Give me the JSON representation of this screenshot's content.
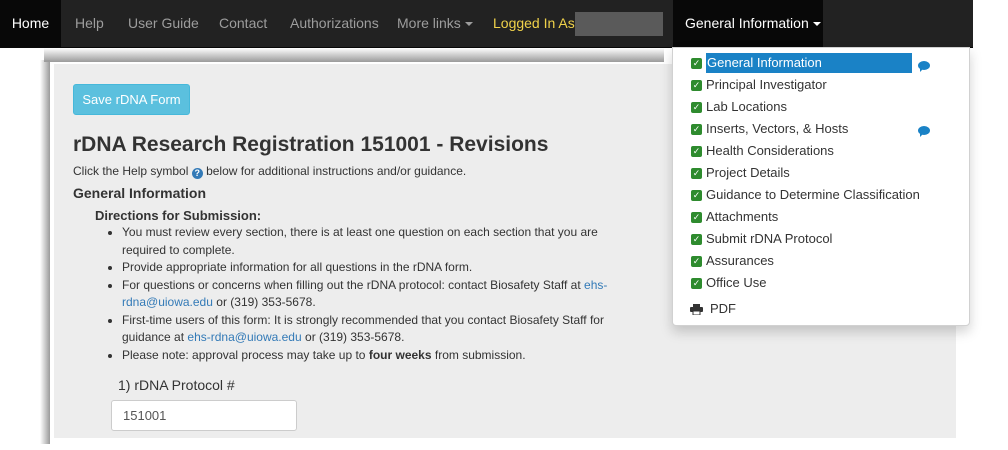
{
  "navbar": {
    "home": "Home",
    "help": "Help",
    "user_guide": "User Guide",
    "contact": "Contact",
    "authorizations": "Authorizations",
    "more_links": "More links",
    "logged_in": "Logged In As:",
    "general_info": "General Information"
  },
  "page": {
    "save_button": "Save rDNA Form",
    "title": "rDNA Research Registration 151001 - Revisions",
    "help_text_before": "Click the Help symbol",
    "help_text_after": "below for additional instructions and/or guidance.",
    "section_title": "General Information",
    "directions_title": "Directions for Submission:",
    "bullets": {
      "b1": "You must review every section, there is at least one question on each section that you are required to complete.",
      "b2": "Provide appropriate information for all questions in the rDNA form.",
      "b3_pre": "For questions or concerns when filling out the rDNA protocol: contact Biosafety Staff at",
      "b3_link": "ehs-rdna@uiowa.edu",
      "b3_post": "or (319) 353-5678.",
      "b4_pre": "First-time users of this form: It is strongly recommended that you contact Biosafety Staff for guidance at",
      "b4_link": "ehs-rdna@uiowa.edu",
      "b4_post": "or (319) 353-5678.",
      "b5_pre": "Please note: approval process may take up to",
      "b5_bold": "four weeks",
      "b5_post": "from submission."
    },
    "field_label": "1) rDNA Protocol #",
    "field_value": "151001"
  },
  "dropdown": {
    "items": [
      {
        "label": "General Information"
      },
      {
        "label": "Principal Investigator"
      },
      {
        "label": "Lab Locations"
      },
      {
        "label": "Inserts, Vectors, & Hosts"
      },
      {
        "label": "Health Considerations"
      },
      {
        "label": "Project Details"
      },
      {
        "label": "Guidance to Determine Classification"
      },
      {
        "label": "Attachments"
      },
      {
        "label": "Submit rDNA Protocol"
      },
      {
        "label": "Assurances"
      },
      {
        "label": "Office Use"
      }
    ],
    "pdf": "PDF"
  },
  "colors": {
    "navbar_bg": "#222222",
    "active_tab_bg": "#080808",
    "logged_in_text": "#f0d24a",
    "save_button_bg": "#5bc0de",
    "link": "#337ab7",
    "menu_highlight": "#1a82c6",
    "checkbox": "#2e8b2e"
  }
}
